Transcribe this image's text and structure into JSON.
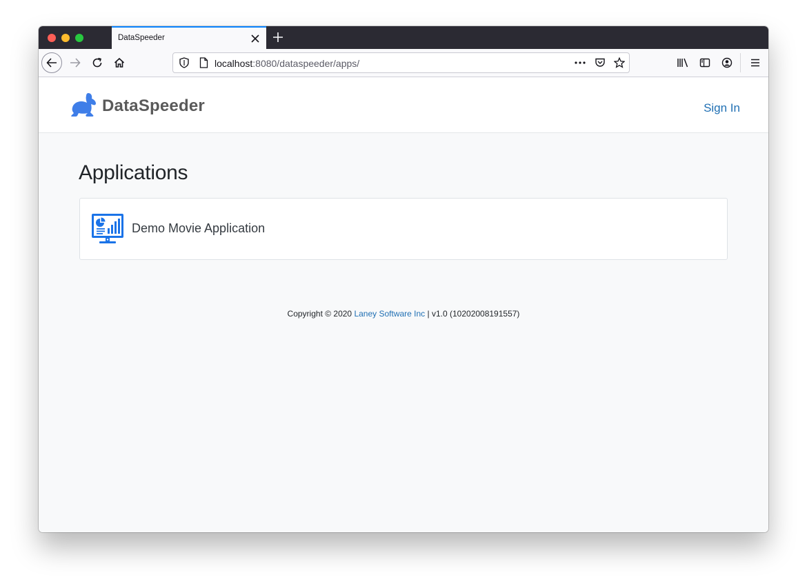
{
  "browser": {
    "tab_title": "DataSpeeder",
    "url_host": "localhost",
    "url_rest": ":8080/dataspeeder/apps/"
  },
  "icons": {
    "back": "back-arrow-icon",
    "forward": "forward-arrow-icon",
    "reload": "reload-icon",
    "home": "home-icon",
    "shield": "shield-icon",
    "page": "page-icon",
    "more": "more-dots-icon",
    "pocket": "pocket-icon",
    "bookmark": "star-icon",
    "library": "library-icon",
    "sidebar": "sidebar-icon",
    "account": "account-icon",
    "menu": "hamburger-menu-icon"
  },
  "header": {
    "brand": "DataSpeeder",
    "sign_in": "Sign In"
  },
  "main": {
    "title": "Applications",
    "apps": [
      {
        "name": "Demo Movie Application"
      }
    ]
  },
  "footer": {
    "copyright": "Copyright © 2020",
    "company": "Laney Software Inc",
    "version": "| v1.0 (10202008191557)"
  },
  "colors": {
    "accent": "#1f6fb3",
    "brand_blue": "#3f7ee8",
    "icon_blue": "#1a73e8"
  }
}
